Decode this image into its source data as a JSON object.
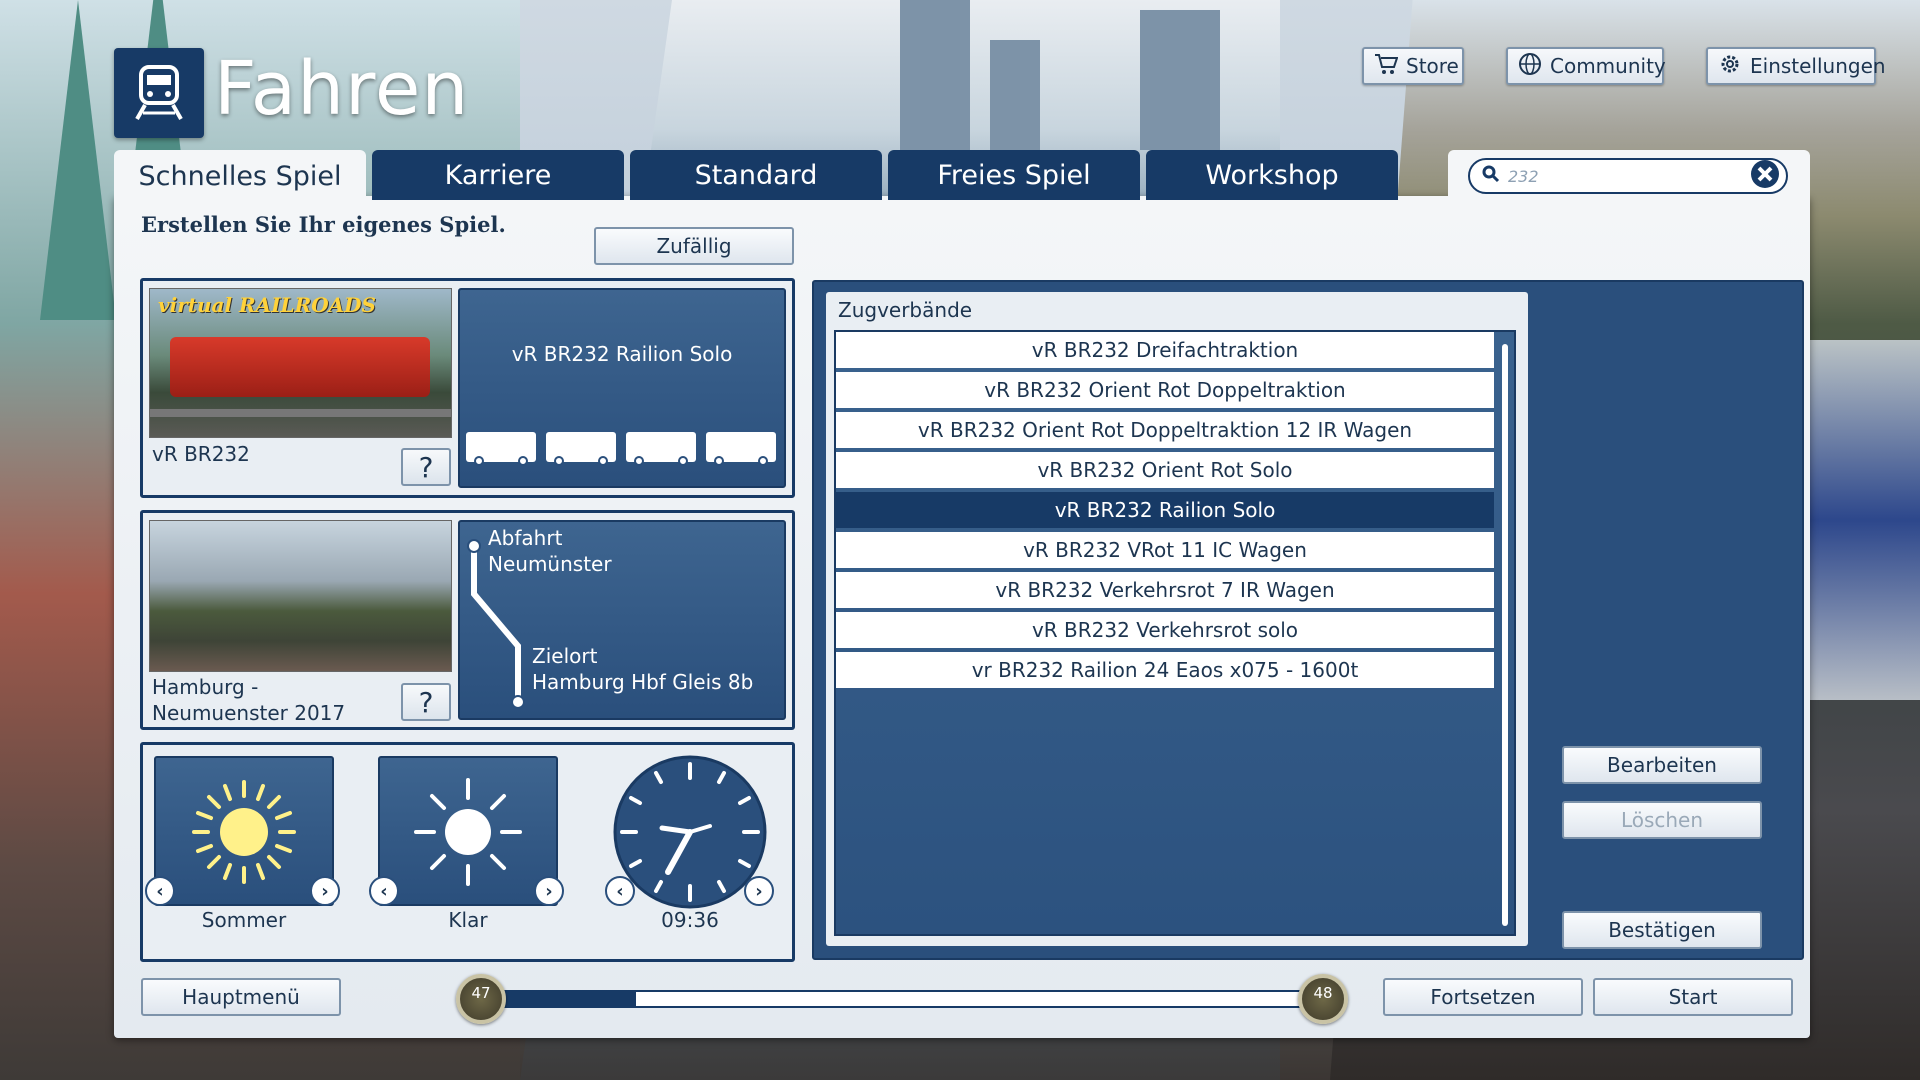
{
  "header": {
    "title": "Fahren",
    "store_label": "Store",
    "community_label": "Community",
    "settings_label": "Einstellungen"
  },
  "tabs": [
    {
      "label": "Schnelles Spiel",
      "active": true
    },
    {
      "label": "Karriere",
      "active": false
    },
    {
      "label": "Standard",
      "active": false
    },
    {
      "label": "Freies Spiel",
      "active": false
    },
    {
      "label": "Workshop",
      "active": false
    }
  ],
  "search": {
    "value": "232",
    "placeholder": "232"
  },
  "subtitle": "Erstellen Sie Ihr eigenes Spiel.",
  "random_button": "Zufällig",
  "locomotive": {
    "thumbnail_brand": "virtual RAILROADS",
    "name": "vR BR232",
    "consist": "vR BR232 Railion Solo",
    "help": "?"
  },
  "route": {
    "name": "Hamburg - Neumuenster 2017",
    "departure_label": "Abfahrt",
    "departure": "Neumünster",
    "destination_label": "Zielort",
    "destination": "Hamburg Hbf Gleis 8b",
    "help": "?"
  },
  "conditions": {
    "season": "Sommer",
    "weather": "Klar",
    "time": "09:36"
  },
  "consists": {
    "header": "Zugverbände",
    "items": [
      "vR BR232 Dreifachtraktion",
      "vR BR232 Orient Rot Doppeltraktion",
      "vR BR232 Orient Rot Doppeltraktion 12 IR Wagen",
      "vR BR232 Orient Rot Solo",
      "vR BR232 Railion Solo",
      "vR BR232 VRot 11 IC Wagen",
      "vR BR232 Verkehrsrot 7 IR Wagen",
      "vR BR232 Verkehrsrot solo",
      "vr BR232 Railion 24 Eaos x075 - 1600t"
    ],
    "selected_index": 4
  },
  "side_buttons": {
    "edit": "Bearbeiten",
    "delete": "Löschen",
    "confirm": "Bestätigen"
  },
  "footer": {
    "main_menu": "Hauptmenü",
    "continue": "Fortsetzen",
    "start": "Start",
    "level_current": "47",
    "level_next": "48",
    "progress": 0.17
  },
  "colors": {
    "navy": "#173a66",
    "panel": "#f4f6f8",
    "blue_box": "#2a4f7c"
  }
}
